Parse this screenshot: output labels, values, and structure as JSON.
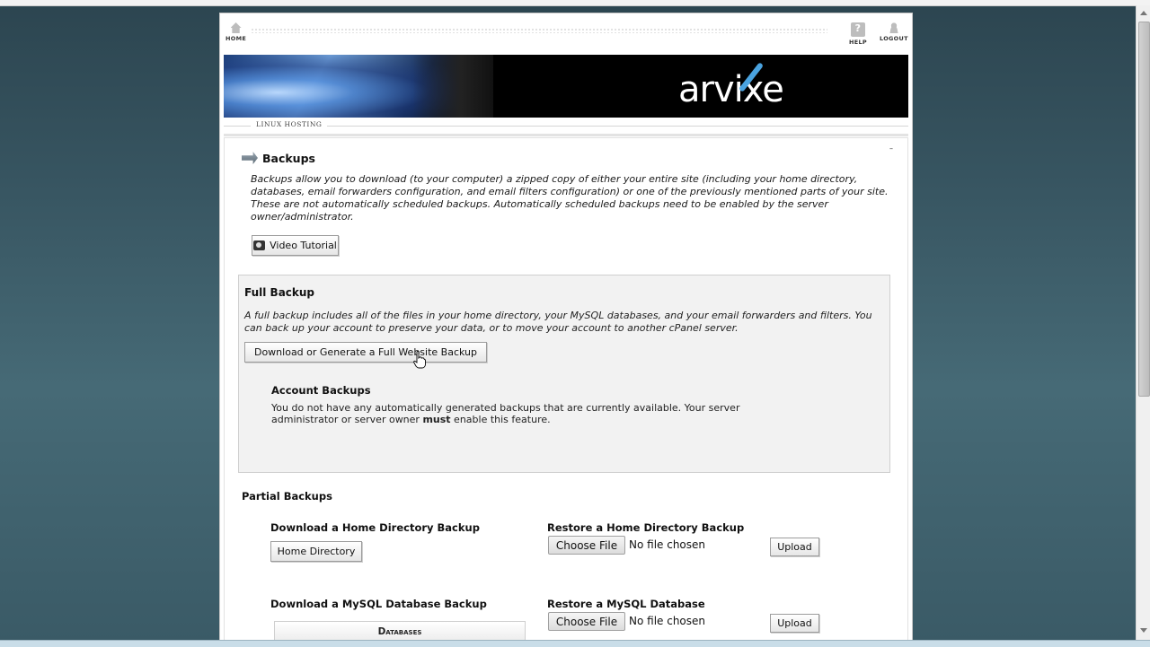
{
  "nav": {
    "home_label": "HOME",
    "help_label": "HELP",
    "logout_label": "LOGOUT"
  },
  "banner": {
    "logo_text_left": "arvi",
    "logo_text_right": "xe"
  },
  "subheader": {
    "label": "LINUX HOSTING"
  },
  "page": {
    "title": "Backups",
    "intro": "Backups allow you to download (to your computer) a zipped copy of either your entire site (including your home directory, databases, email forwarders configuration, and email filters configuration) or one of the previously mentioned parts of your site. These are not automatically scheduled backups. Automatically scheduled backups need to be enabled by the server owner/administrator.",
    "video_button": "Video Tutorial"
  },
  "full_backup": {
    "title": "Full Backup",
    "description": "A full backup includes all of the files in your home directory, your MySQL databases, and your email forwarders and filters. You can back up your account to preserve your data, or to move your account to another cPanel server.",
    "button": "Download or Generate a Full Website Backup",
    "account_title": "Account Backups",
    "account_desc_before": "You do not have any automatically generated backups that are currently available. Your server administrator or server owner ",
    "account_desc_bold": "must",
    "account_desc_after": " enable this feature."
  },
  "partial": {
    "title": "Partial Backups",
    "home_download_title": "Download a Home Directory Backup",
    "home_download_button": "Home Directory",
    "home_restore_title": "Restore a Home Directory Backup",
    "mysql_download_title": "Download a MySQL Database Backup",
    "mysql_restore_title": "Restore a MySQL Database",
    "choose_file": "Choose File",
    "no_file": "No file chosen",
    "upload": "Upload",
    "db_header": "Databases"
  }
}
